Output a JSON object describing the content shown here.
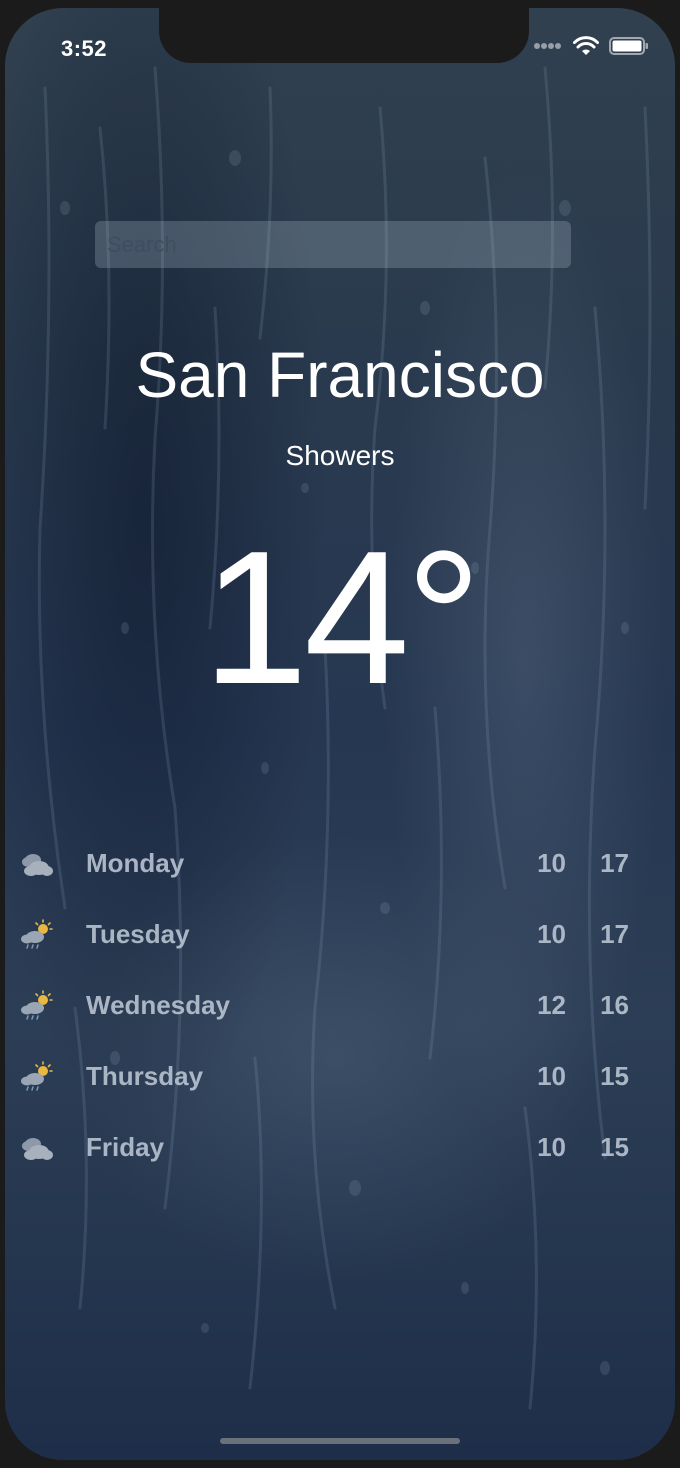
{
  "status_bar": {
    "time": "3:52",
    "signal_icon": "signal-dots-icon",
    "wifi_icon": "wifi-icon",
    "battery_icon": "battery-icon"
  },
  "search": {
    "placeholder": "Search",
    "value": ""
  },
  "weather": {
    "city": "San Francisco",
    "condition": "Showers",
    "temperature": "14°"
  },
  "forecast": [
    {
      "day": "Monday",
      "low": "10",
      "high": "17",
      "icon": "cloudy-icon"
    },
    {
      "day": "Tuesday",
      "low": "10",
      "high": "17",
      "icon": "sun-cloud-rain-icon"
    },
    {
      "day": "Wednesday",
      "low": "12",
      "high": "16",
      "icon": "sun-cloud-rain-icon"
    },
    {
      "day": "Thursday",
      "low": "10",
      "high": "15",
      "icon": "sun-cloud-rain-icon"
    },
    {
      "day": "Friday",
      "low": "10",
      "high": "15",
      "icon": "cloudy-icon"
    }
  ],
  "colors": {
    "text": "#ffffff",
    "forecast_text": "#b9c3d2",
    "sun": "#e8b840",
    "cloud": "#9aa6b4"
  }
}
